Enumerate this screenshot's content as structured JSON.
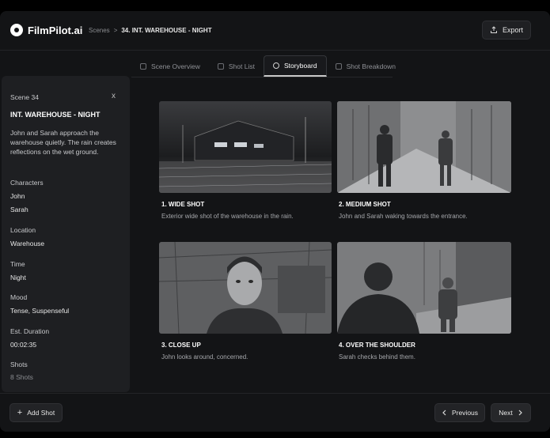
{
  "header": {
    "logo_text": "FilmPilot.ai",
    "breadcrumb": {
      "parent": "Scenes",
      "separator": ">",
      "current": "34. INT. WAREHOUSE - NIGHT"
    },
    "export_label": "Export"
  },
  "tabs": [
    {
      "label": "Scene Overview",
      "icon": "overview-icon",
      "active": false
    },
    {
      "label": "Shot List",
      "icon": "list-icon",
      "active": false
    },
    {
      "label": "Storyboard",
      "icon": "storyboard-icon",
      "active": true
    },
    {
      "label": "Shot Breakdown",
      "icon": "breakdown-icon",
      "active": false
    }
  ],
  "sidebar": {
    "scene_number": "Scene 34",
    "close_glyph": "x",
    "scene_title": "INT. WAREHOUSE - NIGHT",
    "description": "John and Sarah approach the warehouse quietly. The rain creates reflections on the wet ground.",
    "characters_label": "Characters",
    "characters": [
      "John",
      "Sarah"
    ],
    "location_label": "Location",
    "location": "Warehouse",
    "time_label": "Time",
    "time": "Night",
    "mood_label": "Mood",
    "mood": "Tense, Suspenseful",
    "duration_label": "Est. Duration",
    "duration": "00:02:35",
    "shots_label": "Shots",
    "shots": "8 Shots"
  },
  "storyboard": [
    {
      "title": "1. WIDE SHOT",
      "description": "Exterior wide shot of the warehouse in the rain."
    },
    {
      "title": "2. MEDIUM SHOT",
      "description": "John and Sarah waking towards the entrance."
    },
    {
      "title": "3. CLOSE UP",
      "description": "John looks around, concerned."
    },
    {
      "title": "4. OVER THE SHOULDER",
      "description": "Sarah checks behind them."
    }
  ],
  "footer": {
    "add_shot_label": "Add Shot",
    "previous_label": "Previous",
    "next_label": "Next"
  }
}
